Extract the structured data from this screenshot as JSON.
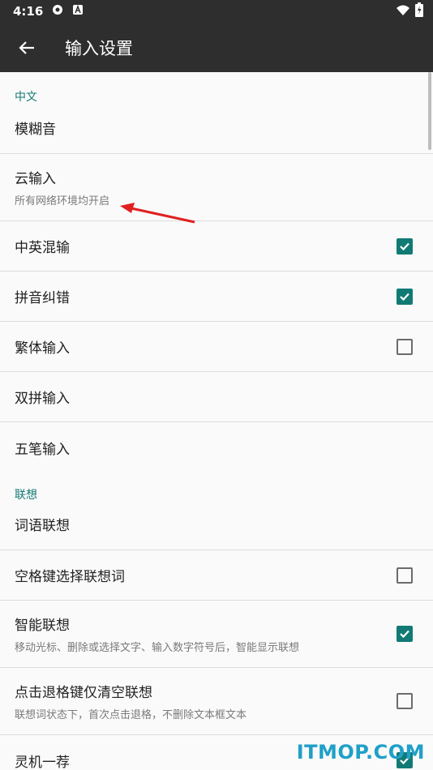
{
  "status_bar": {
    "time": "4:16",
    "icons": [
      "settings-gear-icon",
      "text-a-icon"
    ],
    "right_icons": [
      "wifi-icon",
      "battery-charging-icon"
    ]
  },
  "app_bar": {
    "title": "输入设置",
    "back_icon": "back-arrow-icon"
  },
  "sections": [
    {
      "header": "中文"
    },
    {
      "header": "联想"
    }
  ],
  "items": [
    {
      "title": "模糊音"
    },
    {
      "title": "云输入",
      "summary": "所有网络环境均开启"
    },
    {
      "title": "中英混输",
      "checked": true
    },
    {
      "title": "拼音纠错",
      "checked": true
    },
    {
      "title": "繁体输入",
      "checked": false
    },
    {
      "title": "双拼输入"
    },
    {
      "title": "五笔输入"
    },
    {
      "title": "词语联想"
    },
    {
      "title": "空格键选择联想词",
      "checked": false
    },
    {
      "title": "智能联想",
      "summary": "移动光标、删除或选择文字、输入数字符号后，智能显示联想",
      "checked": true
    },
    {
      "title": "点击退格键仅清空联想",
      "summary": "联想词状态下，首次点击退格，不删除文本框文本",
      "checked": false
    },
    {
      "title": "灵机一荐",
      "checked": true
    }
  ],
  "watermark": "ITMOP.COM",
  "colors": {
    "accent": "#127a74",
    "header_text": "#157a75",
    "bar_bg": "#2e2e2e",
    "annotation_arrow": "#e02020"
  }
}
